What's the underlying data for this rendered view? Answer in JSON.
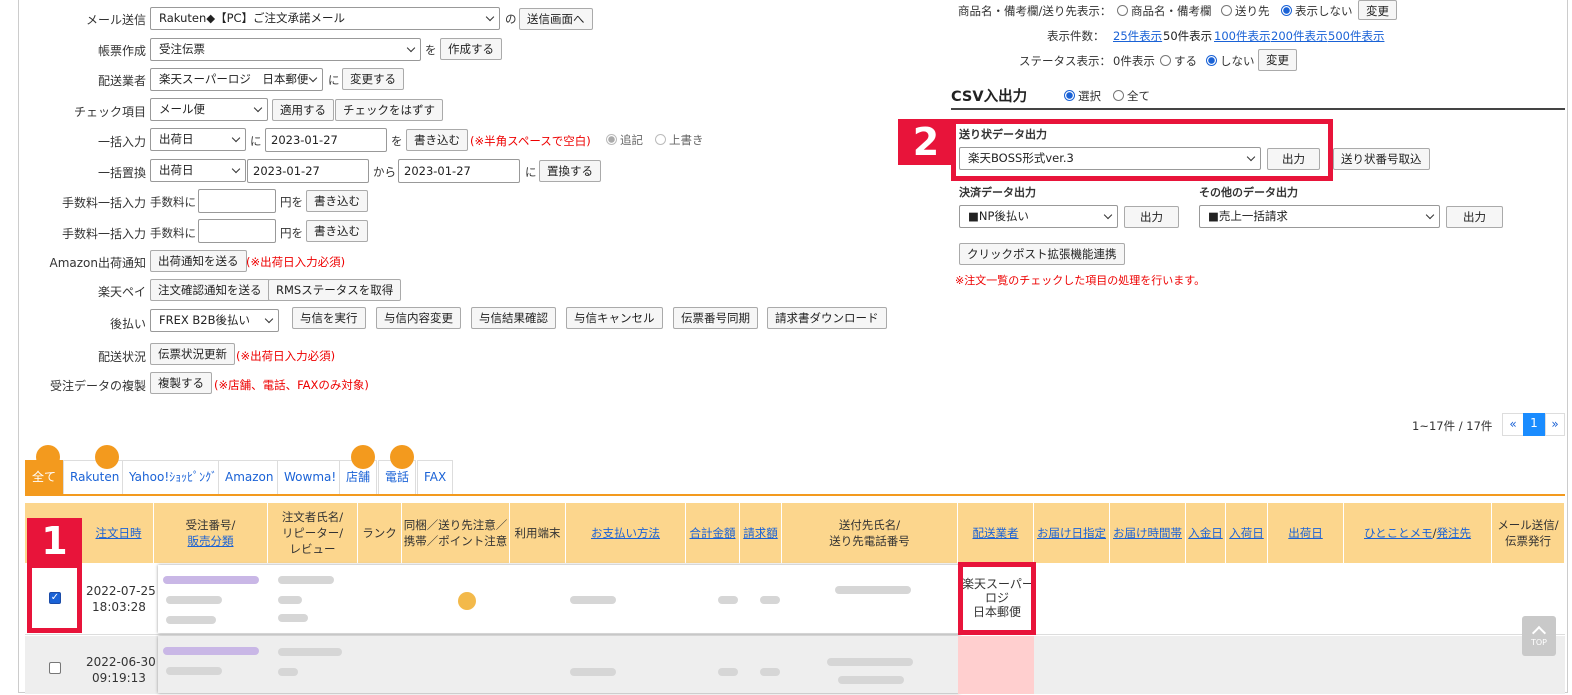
{
  "left_form": {
    "mail": {
      "label": "メール送信",
      "select": "Rakuten◆【PC】ご注文承諾メール",
      "conn": "の",
      "button": "送信画面へ"
    },
    "slip": {
      "label": "帳票作成",
      "select": "受注伝票",
      "conn": "を",
      "button": "作成する"
    },
    "carrier": {
      "label": "配送業者",
      "select": "楽天スーパーロジ　日本郵便",
      "conn": "に",
      "button": "変更する"
    },
    "check": {
      "label": "チェック項目",
      "select": "メール便",
      "button": "適用する",
      "button2": "チェックをはずす"
    },
    "bulk_input": {
      "label": "一括入力",
      "select": "出荷日",
      "conn": "に",
      "value": "2023-01-27",
      "conn2": "を",
      "button": "書き込む",
      "note": "(※半角スペースで空白)",
      "opt1": "追記",
      "opt2": "上書き"
    },
    "bulk_replace": {
      "label": "一括置換",
      "select": "出荷日",
      "value": "2023-01-27",
      "conn": "から",
      "value2": "2023-01-27",
      "conn2": "に",
      "button": "置換する"
    },
    "fee1": {
      "label": "手数料一括入力",
      "prefix": "手数料に",
      "suffix": "円を",
      "button": "書き込む"
    },
    "fee2": {
      "label": "手数料一括入力",
      "prefix": "手数料に",
      "suffix": "円を",
      "button": "書き込む"
    },
    "amazon": {
      "label": "Amazon出荷通知",
      "button": "出荷通知を送る",
      "note": "(※出荷日入力必須)"
    },
    "rakuten_pay": {
      "label": "楽天ペイ",
      "button": "注文確認通知を送る",
      "button2": "RMSステータスを取得"
    },
    "deferred": {
      "label": "後払い",
      "select": "FREX B2B後払い",
      "buttons": [
        "与信を実行",
        "与信内容変更",
        "与信結果確認",
        "与信キャンセル",
        "伝票番号同期",
        "請求書ダウンロード"
      ]
    },
    "shipping": {
      "label": "配送状況",
      "button": "伝票状況更新",
      "note": "(※出荷日入力必須)"
    },
    "duplicate": {
      "label": "受注データの複製",
      "button": "複製する",
      "note": "(※店舗、電話、FAXのみ対象)"
    }
  },
  "right_panel": {
    "display": {
      "label": "商品名・備考欄/送り先表示：",
      "opt1": "商品名・備考欄",
      "opt2": "送り先",
      "opt3": "表示しない",
      "button": "変更"
    },
    "count": {
      "label": "表示件数：",
      "opt1": "25件表示",
      "current": "50件表示",
      "opt3": "100件表示",
      "opt4": "200件表示",
      "opt5": "500件表示"
    },
    "status": {
      "label": "ステータス表示：",
      "opt0": "0件表示",
      "opt1": "する",
      "opt2": "しない",
      "button": "変更"
    },
    "csv": {
      "title": "CSV入出力",
      "opt1": "選択",
      "opt2": "全て"
    },
    "waybill": {
      "title": "送り状データ出力",
      "select": "楽天BOSS形式ver.3",
      "button": "出力",
      "button2": "送り状番号取込"
    },
    "settlement": {
      "title": "決済データ出力",
      "select": "■NP後払い",
      "button": "出力"
    },
    "other": {
      "title": "その他のデータ出力",
      "select": "■売上一括請求",
      "button": "出力"
    },
    "clickpost": "クリックポスト拡張機能連携",
    "note": "※注文一覧のチェックした項目の処理を行います。"
  },
  "pagination": {
    "info": "1~17件 / 17件",
    "prev": "«",
    "current": "1",
    "next": "»"
  },
  "tabs": [
    "全て",
    "Rakuten",
    "Yahoo!ｼｮｯﾋﾟﾝｸﾞ",
    "Amazon",
    "Wowma!",
    "店舗",
    "電話",
    "FAX"
  ],
  "table": {
    "headers": [
      "注文日時",
      "受注番号/\n販売分類",
      "注文者氏名/\nリピーター/\nレビュー",
      "ランク",
      "同梱／送り先注意／\n携帯／ポイント注意",
      "利用端末",
      "お支払い方法",
      "合計金額",
      "請求額",
      "送付先氏名/\n送り先電話番号",
      "配送業者",
      "お届け日指定",
      "お届け時間帯",
      "入金日",
      "入荷日",
      "出荷日",
      "ひとことメモ/発注先",
      "メール送信/\n伝票発行"
    ],
    "row1": {
      "date": "2022-07-25",
      "time": "18:03:28",
      "carrier": "楽天スーパー\nロジ\n日本郵便"
    },
    "row2": {
      "date": "2022-06-30",
      "time": "09:19:13"
    }
  },
  "callouts": {
    "one": "1",
    "two": "2"
  },
  "top_button": "TOP",
  "colors": {
    "accent": "#f39a1e",
    "callout": "#e8143a",
    "header_bg": "#fcd68d",
    "link": "#1a62d6",
    "warn": "#e00000"
  }
}
